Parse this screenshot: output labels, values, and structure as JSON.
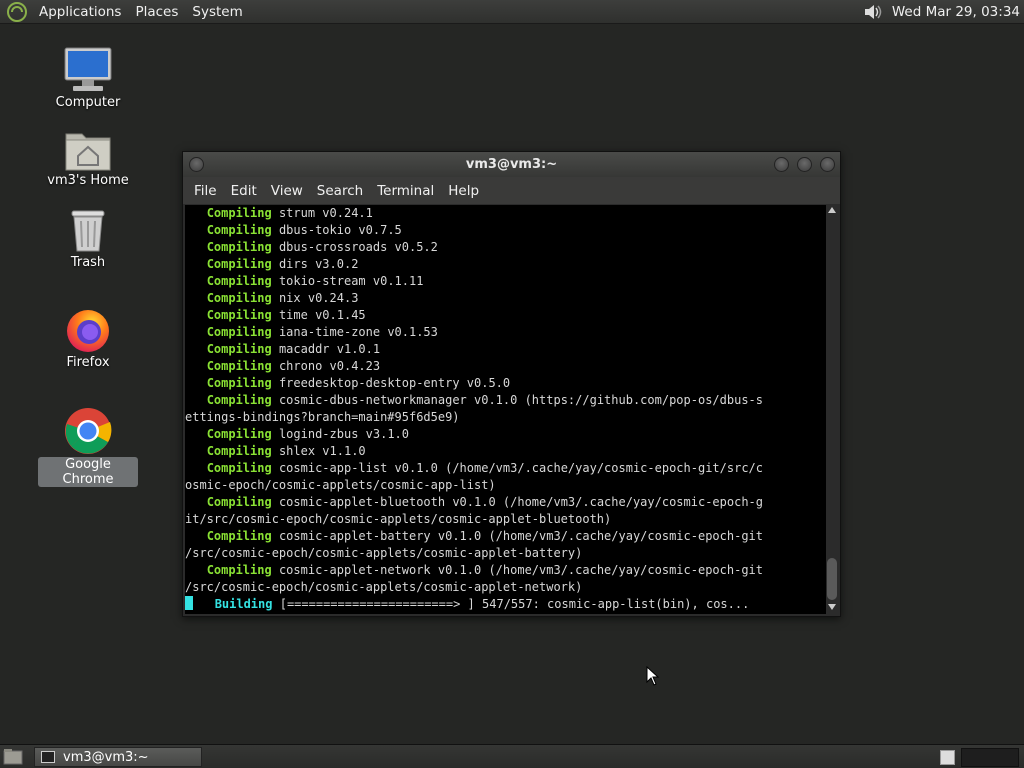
{
  "top_panel": {
    "menus": [
      "Applications",
      "Places",
      "System"
    ],
    "clock": "Wed Mar 29, 03:34"
  },
  "desktop_icons": [
    {
      "label": "Computer",
      "icon": "computer-icon"
    },
    {
      "label": "vm3's Home",
      "icon": "home-folder-icon"
    },
    {
      "label": "Trash",
      "icon": "trash-icon"
    },
    {
      "label": "Firefox",
      "icon": "firefox-icon"
    },
    {
      "label": "Google Chrome",
      "icon": "chrome-icon",
      "selected": true
    }
  ],
  "terminal": {
    "title": "vm3@vm3:~",
    "menus": [
      "File",
      "Edit",
      "View",
      "Search",
      "Terminal",
      "Help"
    ],
    "lines": [
      [
        "   ",
        "Compiling",
        " strum v0.24.1"
      ],
      [
        "   ",
        "Compiling",
        " dbus-tokio v0.7.5"
      ],
      [
        "   ",
        "Compiling",
        " dbus-crossroads v0.5.2"
      ],
      [
        "   ",
        "Compiling",
        " dirs v3.0.2"
      ],
      [
        "   ",
        "Compiling",
        " tokio-stream v0.1.11"
      ],
      [
        "   ",
        "Compiling",
        " nix v0.24.3"
      ],
      [
        "   ",
        "Compiling",
        " time v0.1.45"
      ],
      [
        "   ",
        "Compiling",
        " iana-time-zone v0.1.53"
      ],
      [
        "   ",
        "Compiling",
        " macaddr v1.0.1"
      ],
      [
        "   ",
        "Compiling",
        " chrono v0.4.23"
      ],
      [
        "   ",
        "Compiling",
        " freedesktop-desktop-entry v0.5.0"
      ],
      [
        "   ",
        "Compiling",
        " cosmic-dbus-networkmanager v0.1.0 (https://github.com/pop-os/dbus-s"
      ],
      [
        "",
        "",
        "ettings-bindings?branch=main#95f6d5e9)"
      ],
      [
        "   ",
        "Compiling",
        " logind-zbus v3.1.0"
      ],
      [
        "   ",
        "Compiling",
        " shlex v1.1.0"
      ],
      [
        "   ",
        "Compiling",
        " cosmic-app-list v0.1.0 (/home/vm3/.cache/yay/cosmic-epoch-git/src/c"
      ],
      [
        "",
        "",
        "osmic-epoch/cosmic-applets/cosmic-app-list)"
      ],
      [
        "   ",
        "Compiling",
        " cosmic-applet-bluetooth v0.1.0 (/home/vm3/.cache/yay/cosmic-epoch-g"
      ],
      [
        "",
        "",
        "it/src/cosmic-epoch/cosmic-applets/cosmic-applet-bluetooth)"
      ],
      [
        "   ",
        "Compiling",
        " cosmic-applet-battery v0.1.0 (/home/vm3/.cache/yay/cosmic-epoch-git"
      ],
      [
        "",
        "",
        "/src/cosmic-epoch/cosmic-applets/cosmic-applet-battery)"
      ],
      [
        "   ",
        "Compiling",
        " cosmic-applet-network v0.1.0 (/home/vm3/.cache/yay/cosmic-epoch-git"
      ],
      [
        "",
        "",
        "/src/cosmic-epoch/cosmic-applets/cosmic-applet-network)"
      ]
    ],
    "status_line": {
      "keyword": "Building",
      "progress_bar": "[=======================> ]",
      "rest": " 547/557: cosmic-app-list(bin), cos..."
    }
  },
  "bottom_panel": {
    "task_label": "vm3@vm3:~"
  },
  "colors": {
    "keyword_green": "#8ae234",
    "keyword_cyan": "#34e2e2",
    "desktop_bg": "#252624"
  }
}
